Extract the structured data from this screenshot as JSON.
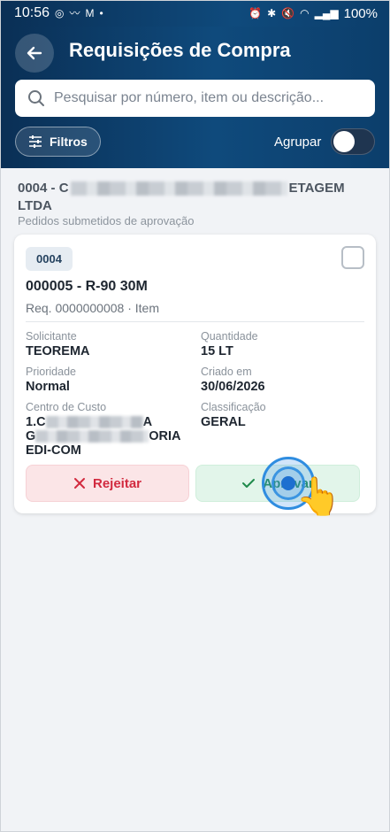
{
  "status_bar": {
    "time": "10:56",
    "battery": "100%"
  },
  "header": {
    "title": "Requisições de Compra",
    "search_placeholder": "Pesquisar por número, item ou descrição...",
    "filters_label": "Filtros",
    "group_label": "Agrupar",
    "group_toggle_on": false
  },
  "group": {
    "company_prefix": "0004 - C",
    "company_suffix": "ETAGEM",
    "company_line2": "LTDA",
    "subtitle": "Pedidos submetidos de aprovação"
  },
  "card": {
    "badge": "0004",
    "title": "000005 - R-90 30M",
    "req_line": "Req. 0000000008 · Item",
    "fields": {
      "solicitante_label": "Solicitante",
      "solicitante_value": "TEOREMA",
      "quantidade_label": "Quantidade",
      "quantidade_value": "15 LT",
      "prioridade_label": "Prioridade",
      "prioridade_value": "Normal",
      "criado_label": "Criado em",
      "criado_value": "30/06/2026",
      "centro_label": "Centro de Custo",
      "centro_line1_start": "1.C",
      "centro_line1_end": "A",
      "centro_line2_start": "G",
      "centro_line2_end": "ORIA",
      "centro_line3": "EDI-COM",
      "classificacao_label": "Classificação",
      "classificacao_value": "GERAL"
    },
    "reject_label": "Rejeitar",
    "approve_label": "Aprovar"
  },
  "colors": {
    "header_bg": "#0f4a7c",
    "reject": "#d22a3f",
    "approve": "#1f8a4c"
  }
}
